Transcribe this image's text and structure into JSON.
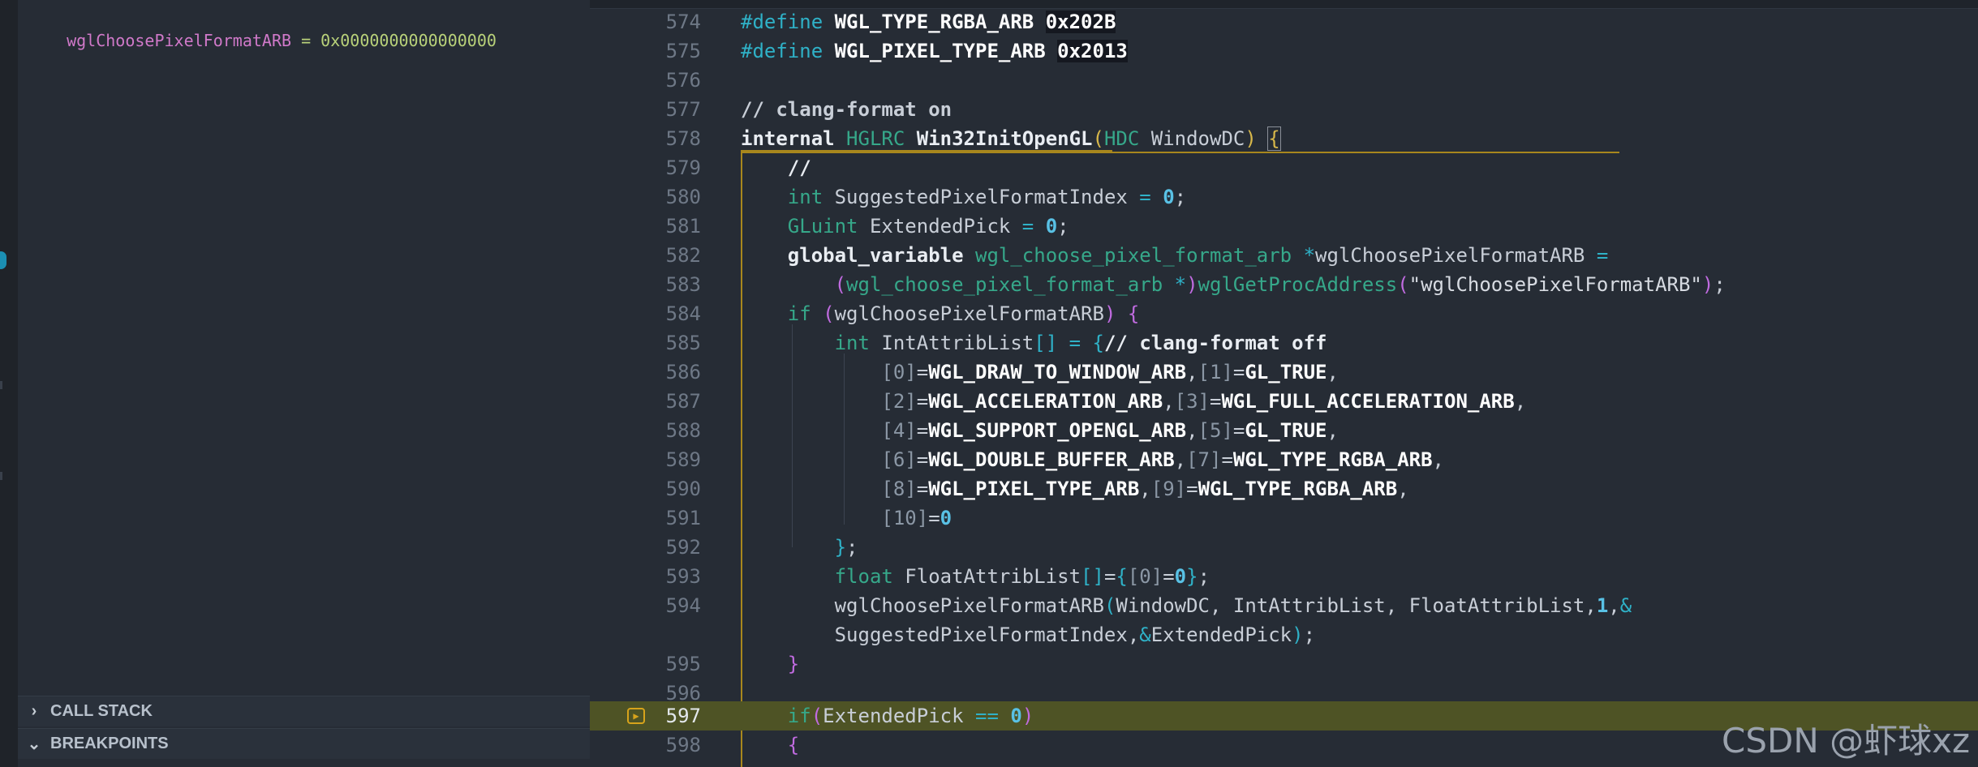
{
  "variables": {
    "name": "wglChoosePixelFormatARB",
    "separator": " = ",
    "value": "0x0000000000000000"
  },
  "sections": {
    "callstack": "CALL STACK",
    "breakpoints": "BREAKPOINTS"
  },
  "editor": {
    "current_line": "597",
    "lines": [
      {
        "n": "574",
        "text": "#define WGL_TYPE_RGBA_ARB 0x202B"
      },
      {
        "n": "575",
        "text": "#define WGL_PIXEL_TYPE_ARB 0x2013"
      },
      {
        "n": "576",
        "text": ""
      },
      {
        "n": "577",
        "text": "// clang-format on"
      },
      {
        "n": "578",
        "text": "internal HGLRC Win32InitOpenGL(HDC WindowDC) {"
      },
      {
        "n": "579",
        "text": "    //"
      },
      {
        "n": "580",
        "text": "    int SuggestedPixelFormatIndex = 0;"
      },
      {
        "n": "581",
        "text": "    GLuint ExtendedPick = 0;"
      },
      {
        "n": "582",
        "text": "    global_variable wgl_choose_pixel_format_arb *wglChoosePixelFormatARB ="
      },
      {
        "n": "583",
        "text": "        (wgl_choose_pixel_format_arb *)wglGetProcAddress(\"wglChoosePixelFormatARB\");"
      },
      {
        "n": "584",
        "text": "    if (wglChoosePixelFormatARB) {"
      },
      {
        "n": "585",
        "text": "        int IntAttribList[] = {// clang-format off"
      },
      {
        "n": "586",
        "text": "            [0]=WGL_DRAW_TO_WINDOW_ARB,[1]=GL_TRUE,"
      },
      {
        "n": "587",
        "text": "            [2]=WGL_ACCELERATION_ARB,[3]=WGL_FULL_ACCELERATION_ARB,"
      },
      {
        "n": "588",
        "text": "            [4]=WGL_SUPPORT_OPENGL_ARB,[5]=GL_TRUE,"
      },
      {
        "n": "589",
        "text": "            [6]=WGL_DOUBLE_BUFFER_ARB,[7]=WGL_TYPE_RGBA_ARB,"
      },
      {
        "n": "590",
        "text": "            [8]=WGL_PIXEL_TYPE_ARB,[9]=WGL_TYPE_RGBA_ARB,"
      },
      {
        "n": "591",
        "text": "            [10]=0"
      },
      {
        "n": "592",
        "text": "        };"
      },
      {
        "n": "593",
        "text": "        float FloatAttribList[]={[0]=0};"
      },
      {
        "n": "594",
        "text": "        wglChoosePixelFormatARB(WindowDC, IntAttribList, FloatAttribList,1,&"
      },
      {
        "n": "",
        "text": "        SuggestedPixelFormatIndex,&ExtendedPick);"
      },
      {
        "n": "595",
        "text": "    }"
      },
      {
        "n": "596",
        "text": ""
      },
      {
        "n": "597",
        "text": "    if(ExtendedPick == 0)"
      },
      {
        "n": "598",
        "text": "    {"
      }
    ]
  },
  "watermark": "CSDN @虾球xz",
  "colors": {
    "background": "#262c35",
    "current_line_highlight": "#4e5325",
    "scope_guide": "#a8871d",
    "breakpoint_arrow": "#d7a31b"
  },
  "icons": [
    "chevron-right-icon",
    "chevron-down-icon",
    "breakpoint-arrow-icon",
    "text-cursor-icon"
  ]
}
